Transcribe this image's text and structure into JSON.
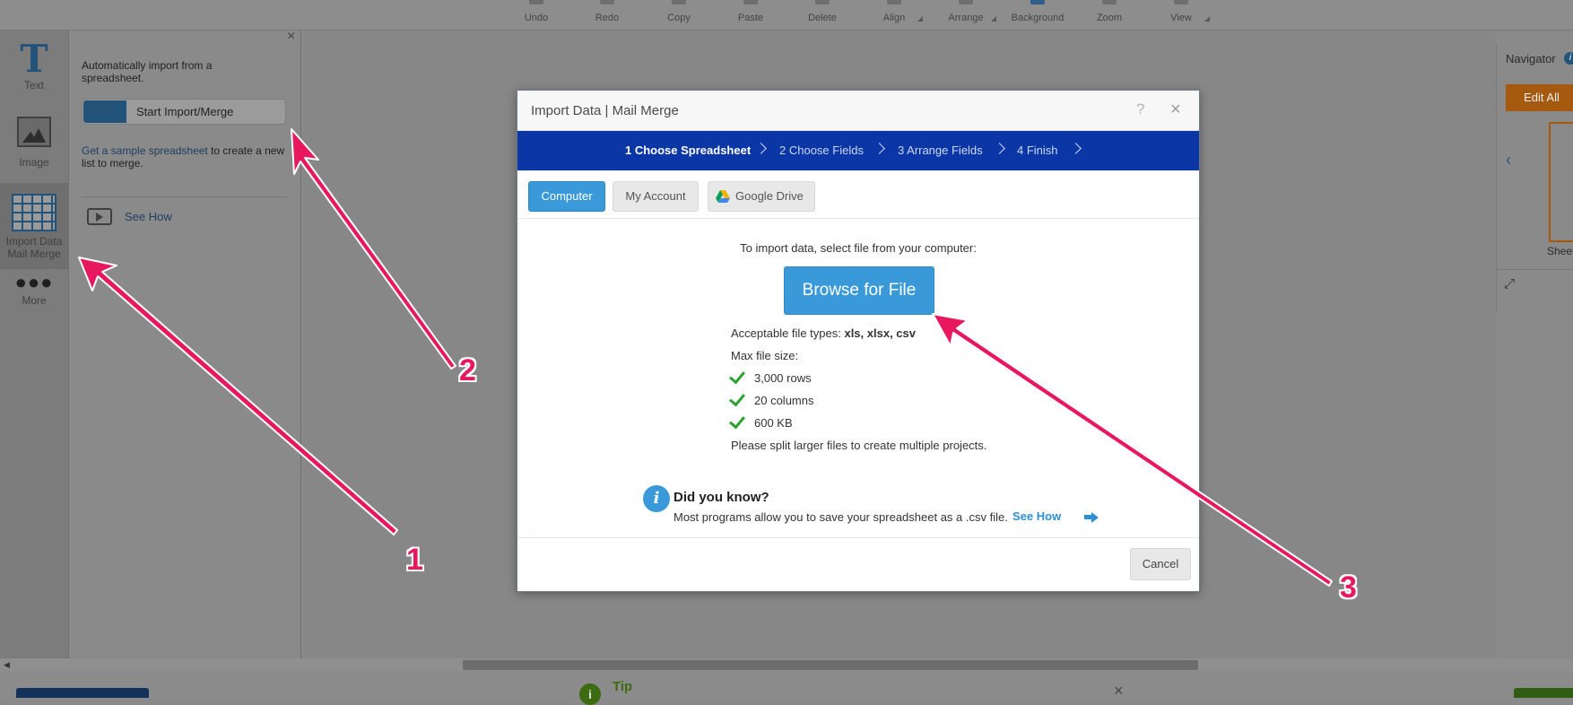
{
  "toolbar": {
    "items": [
      {
        "label": "Undo",
        "icon": "undo-icon"
      },
      {
        "label": "Redo",
        "icon": "redo-icon"
      },
      {
        "label": "Copy",
        "icon": "copy-icon"
      },
      {
        "label": "Paste",
        "icon": "paste-icon"
      },
      {
        "label": "Delete",
        "icon": "delete-icon"
      },
      {
        "label": "Align",
        "icon": "align-icon"
      },
      {
        "label": "Arrange",
        "icon": "arrange-icon"
      },
      {
        "label": "Background",
        "icon": "background-icon"
      },
      {
        "label": "Zoom",
        "icon": "zoom-icon"
      },
      {
        "label": "View",
        "icon": "view-icon"
      }
    ]
  },
  "rail": {
    "text_label": "Text",
    "image_label": "Image",
    "import_label_1": "Import Data",
    "import_label_2": "Mail Merge",
    "more_label": "More"
  },
  "panel": {
    "intro": "Automatically import from a spreadsheet.",
    "start_button": "Start Import/Merge",
    "sample_link": "Get a sample spreadsheet",
    "sample_rest": " to create a new list to merge.",
    "see_how": "See How"
  },
  "navigator": {
    "title": "Navigator",
    "edit_all": "Edit All",
    "sheet": "Sheet"
  },
  "modal": {
    "title": "Import Data | Mail Merge",
    "help": "?",
    "close": "×",
    "steps": [
      "1 Choose Spreadsheet",
      "2 Choose Fields",
      "3 Arrange Fields",
      "4 Finish"
    ],
    "tabs": {
      "computer": "Computer",
      "my_account": "My Account",
      "google_drive": "Google Drive"
    },
    "instruction": "To import data, select file from your computer:",
    "browse_button": "Browse for File",
    "file_types_label": "Acceptable file types: ",
    "file_types_value": "xls, xlsx, csv",
    "max_size_label": "Max file size:",
    "limits": [
      "3,000 rows",
      "20 columns",
      "600 KB"
    ],
    "split_note": "Please split larger files to create multiple projects.",
    "did_you_know_title": "Did you know?",
    "did_you_know_text": "Most programs allow you to save your spreadsheet as a .csv file.",
    "see_how_link": "See How",
    "cancel_button": "Cancel"
  },
  "bottom": {
    "tip_label": "Tip",
    "tip_close": "×"
  },
  "annotations": [
    "1",
    "2",
    "3"
  ],
  "colors": {
    "accent_blue": "#3a9ad9",
    "steps_bar": "#0a37a5",
    "annotation": "#e8185e",
    "check_green": "#2da12f"
  }
}
